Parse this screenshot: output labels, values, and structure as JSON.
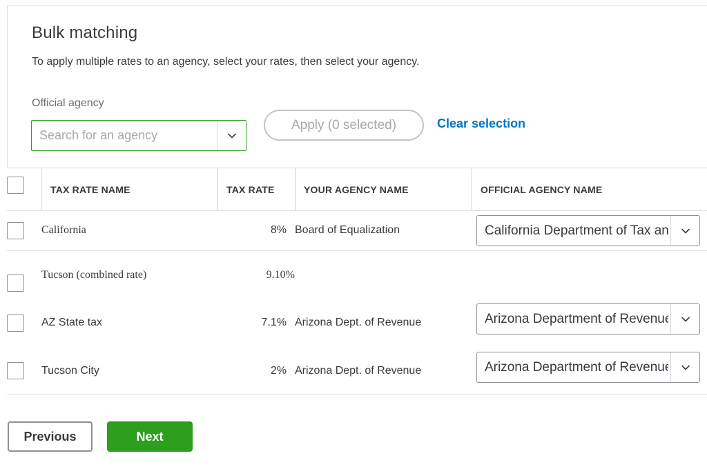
{
  "header": {
    "title": "Bulk matching",
    "subtitle": "To apply multiple rates to an agency, select your rates, then select your agency."
  },
  "agency_search": {
    "label": "Official agency",
    "placeholder": "Search for an agency",
    "value": ""
  },
  "actions": {
    "apply_label": "Apply (0 selected)",
    "clear_label": "Clear selection"
  },
  "table": {
    "columns": {
      "tax_rate_name": "TAX RATE NAME",
      "tax_rate": "TAX RATE",
      "your_agency_name": "YOUR AGENCY NAME",
      "official_agency_name": "OFFICIAL AGENCY NAME"
    },
    "rows": [
      {
        "name": "California",
        "rate": "8%",
        "agency": "Board of Equalization",
        "official": "California Department of Tax and Fee Administration"
      },
      {
        "name": "Tucson (combined rate)",
        "rate": "9.10%",
        "agency": "",
        "official": ""
      },
      {
        "name": "AZ State tax",
        "rate": "7.1%",
        "agency": "Arizona Dept. of Revenue",
        "official": "Arizona Department of Revenue"
      },
      {
        "name": "Tucson City",
        "rate": "2%",
        "agency": "Arizona Dept. of Revenue",
        "official": "Arizona Department of Revenue"
      }
    ]
  },
  "footer": {
    "previous_label": "Previous",
    "next_label": "Next"
  },
  "colors": {
    "accent_green": "#2ca01c",
    "link_blue": "#0077c5",
    "text": "#393a3d"
  },
  "icons": {
    "dropdown": "chevron-down-icon"
  }
}
